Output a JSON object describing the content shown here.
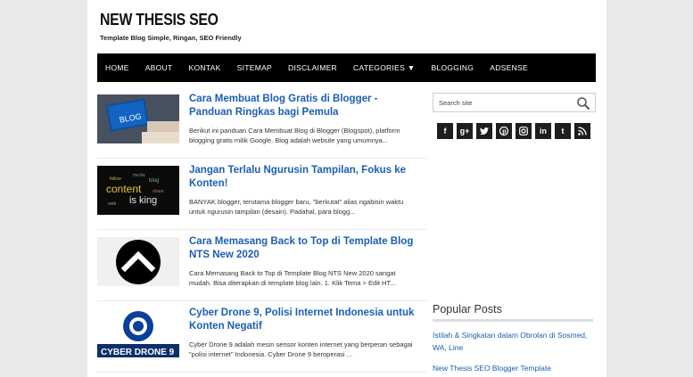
{
  "blog": {
    "title": "NEW THESIS SEO",
    "description": "Template Blog Simple, Ringan, SEO Friendly"
  },
  "nav": [
    "HOME",
    "ABOUT",
    "KONTAK",
    "SITEMAP",
    "DISCLAIMER",
    "CATEGORIES ▼",
    "BLOGGING",
    "ADSENSE"
  ],
  "posts": [
    {
      "title": "Cara Membuat Blog Gratis di Blogger - Panduan Ringkas bagi Pemula",
      "snippet": "Berikut ini panduan Cara Membuat Blog di Blogger (Blogspot), platform blogging gratis milik Google. Blog adalah website yang umumnya..."
    },
    {
      "title": "Jangan Terlalu Ngurusin Tampilan, Fokus ke Konten!",
      "snippet": "BANYAK blogger, terutama blogger baru, \"berkutat\" alias ngabisin waktu untuk ngurusin tampilan (desain). Padahal, para blogg..."
    },
    {
      "title": "Cara Memasang Back to Top di Template Blog NTS New 2020",
      "snippet": "Cara Memasang Back to Top di Template Blog NTS New 2020 sangat mudah. Bisa diterapkan di template blog lain. 1. Klik Tema > Edit HT..."
    },
    {
      "title": "Cyber Drone 9, Polisi Internet Indonesia untuk Konten Negatif",
      "snippet": "Cyber Drone 9 adalah mesin sensor konten internet yang berperan sebagai \"polisi internet\" Indonesia.  Cyber Drone 9 beroperasi ..."
    }
  ],
  "thumbs": {
    "blog_label": "BLOG",
    "content_words": [
      "content",
      "is king"
    ],
    "drone_label": "CYBER DRONE 9"
  },
  "sidebar": {
    "search_placeholder": "Search site",
    "social": [
      "f",
      "g+",
      "t",
      "p",
      "ig",
      "in",
      "t",
      "rss"
    ],
    "popular_title": "Popular Posts",
    "popular": [
      "Istilah & Singkatan dalam Obrolan di Sosmed, WA, Line",
      "New Thesis SEO Blogger Template"
    ]
  },
  "colors": {
    "link": "#1a5fb4",
    "nav_bg": "#000000"
  }
}
